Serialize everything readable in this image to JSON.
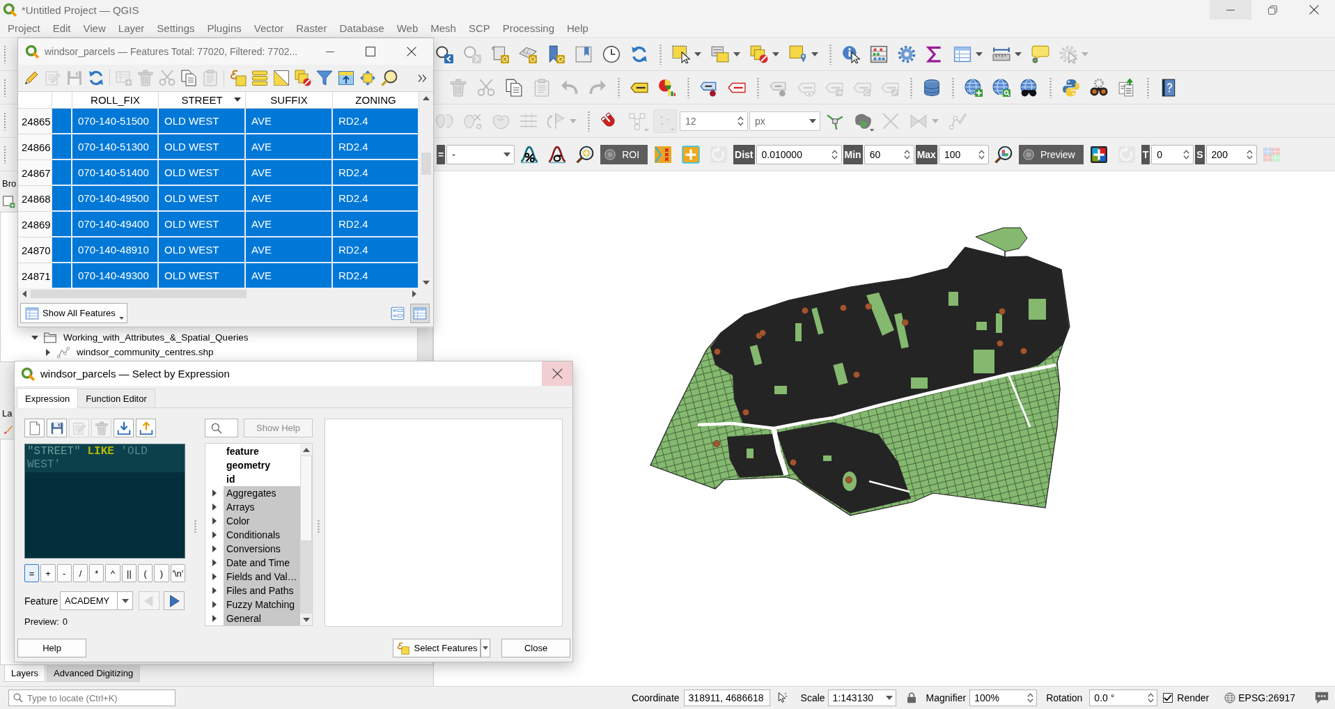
{
  "window": {
    "title": "*Untitled Project — QGIS"
  },
  "menu": [
    "Project",
    "Edit",
    "View",
    "Layer",
    "Settings",
    "Plugins",
    "Vector",
    "Raster",
    "Database",
    "Web",
    "Mesh",
    "SCP",
    "Processing",
    "Help"
  ],
  "toolbars": [
    {
      "groups": [
        [
          {
            "kind": "icon",
            "disabled": false
          },
          {
            "kind": "icon",
            "disabled": true
          },
          {
            "kind": "icon",
            "disabled": false
          },
          {
            "kind": "icon",
            "disabled": false
          },
          {
            "kind": "icon",
            "disabled": false
          },
          {
            "kind": "icon",
            "disabled": false
          },
          {
            "kind": "icon",
            "disabled": false
          },
          {
            "kind": "icon",
            "disabled": false
          }
        ],
        [
          {
            "kind": "menu_icon",
            "disabled": false
          },
          {
            "kind": "menu_icon",
            "disabled": false
          },
          {
            "kind": "menu_icon",
            "disabled": false
          },
          {
            "kind": "menu_icon",
            "disabled": false
          }
        ],
        [
          {
            "kind": "icon",
            "disabled": false
          },
          {
            "kind": "icon",
            "disabled": false
          },
          {
            "kind": "icon",
            "disabled": false
          },
          {
            "kind": "icon",
            "disabled": false
          },
          {
            "kind": "menu_icon",
            "disabled": false
          },
          {
            "kind": "menu_icon",
            "disabled": false
          },
          {
            "kind": "icon",
            "disabled": false
          },
          {
            "kind": "menu_icon",
            "disabled": true
          }
        ]
      ]
    },
    {
      "groups": [
        [
          {
            "kind": "icon",
            "disabled": true
          },
          {
            "kind": "icon",
            "disabled": true
          },
          {
            "kind": "icon",
            "disabled": false
          },
          {
            "kind": "icon",
            "disabled": true
          },
          {
            "kind": "icon",
            "disabled": true
          },
          {
            "kind": "icon",
            "disabled": true
          }
        ],
        [
          {
            "kind": "icon",
            "disabled": false
          },
          {
            "kind": "icon",
            "disabled": false
          }
        ],
        [
          {
            "kind": "icon",
            "disabled": false
          },
          {
            "kind": "icon",
            "disabled": false
          }
        ],
        [
          {
            "kind": "icon",
            "disabled": true
          },
          {
            "kind": "icon",
            "disabled": true
          },
          {
            "kind": "icon",
            "disabled": true
          },
          {
            "kind": "icon",
            "disabled": true
          },
          {
            "kind": "icon",
            "disabled": true
          }
        ],
        [
          {
            "kind": "icon",
            "disabled": false
          }
        ],
        [
          {
            "kind": "icon",
            "disabled": false
          },
          {
            "kind": "icon",
            "disabled": false
          },
          {
            "kind": "icon",
            "disabled": false
          }
        ],
        [
          {
            "kind": "icon",
            "disabled": false
          },
          {
            "kind": "icon",
            "disabled": false
          },
          {
            "kind": "icon",
            "disabled": false
          }
        ],
        [
          {
            "kind": "icon",
            "disabled": false
          }
        ]
      ]
    },
    {
      "groups": [
        [
          {
            "kind": "icon",
            "disabled": true
          },
          {
            "kind": "icon",
            "disabled": true
          },
          {
            "kind": "icon",
            "disabled": true
          },
          {
            "kind": "icon",
            "disabled": true
          },
          {
            "kind": "menu_icon",
            "disabled": true
          }
        ],
        [
          {
            "kind": "icon",
            "disabled": false
          },
          {
            "kind": "corner_menu_icon",
            "disabled": true
          },
          {
            "kind": "icon",
            "disabled": true
          },
          {
            "kind": "spin",
            "value": "12",
            "disabled": true
          },
          {
            "kind": "combo",
            "value": "px",
            "disabled": true
          },
          {
            "kind": "icon",
            "disabled": false
          },
          {
            "kind": "corner_menu_icon",
            "disabled": false
          },
          {
            "kind": "icon",
            "disabled": true
          },
          {
            "kind": "menu_icon",
            "disabled": true
          },
          {
            "kind": "icon",
            "disabled": true
          }
        ]
      ]
    },
    {
      "groups": [
        [
          {
            "kind": "label",
            "text": "=",
            "disabled": false
          },
          {
            "kind": "combo",
            "value": "-",
            "disabled": false
          },
          {
            "kind": "icon",
            "disabled": false
          },
          {
            "kind": "icon",
            "disabled": false
          },
          {
            "kind": "icon",
            "disabled": false
          },
          {
            "kind": "toggle",
            "text": "ROI",
            "checked": false,
            "disabled": false
          },
          {
            "kind": "icon",
            "disabled": false
          },
          {
            "kind": "icon",
            "disabled": false
          },
          {
            "kind": "icon",
            "disabled": true
          },
          {
            "kind": "label",
            "text": "Dist",
            "disabled": false
          },
          {
            "kind": "spin",
            "value": "0.010000",
            "disabled": false
          },
          {
            "kind": "label",
            "text": "Min",
            "disabled": false
          },
          {
            "kind": "spin",
            "value": "60",
            "disabled": false
          },
          {
            "kind": "label",
            "text": "Max",
            "disabled": false
          },
          {
            "kind": "spin",
            "value": "100",
            "disabled": false
          },
          {
            "kind": "icon",
            "disabled": false
          },
          {
            "kind": "toggle",
            "text": "Preview",
            "checked": false,
            "disabled": false
          },
          {
            "kind": "icon",
            "disabled": false
          },
          {
            "kind": "icon",
            "disabled": true
          },
          {
            "kind": "label",
            "text": "T",
            "disabled": false
          },
          {
            "kind": "spin",
            "value": "0",
            "disabled": false
          },
          {
            "kind": "label",
            "text": "S",
            "disabled": false
          },
          {
            "kind": "spin",
            "value": "200",
            "disabled": false
          },
          {
            "kind": "icon",
            "disabled": false
          }
        ]
      ]
    }
  ],
  "browser_panel": {
    "title": "Bro",
    "tree": [
      {
        "label": "Working_with_Attributes_&_Spatial_Queries",
        "kind": "folder",
        "expanded": true,
        "children": [
          {
            "label": "windsor_community_centres.shp",
            "kind": "layer",
            "expanded": false
          }
        ]
      }
    ]
  },
  "layers_panel": {
    "title": "La"
  },
  "dock_tabs": [
    {
      "label": "Layers",
      "selected": true
    },
    {
      "label": "Advanced Digitizing",
      "selected": false
    }
  ],
  "attribute_table": {
    "title": "windsor_parcels — Features Total: 77020, Filtered: 7702...",
    "toolbar": {
      "groups": [
        [
          {
            "kind": "icon",
            "disabled": false
          },
          {
            "kind": "icon",
            "disabled": true
          },
          {
            "kind": "icon",
            "disabled": true
          },
          {
            "kind": "icon",
            "disabled": false
          }
        ],
        [
          {
            "kind": "icon",
            "disabled": true
          },
          {
            "kind": "icon",
            "disabled": true
          },
          {
            "kind": "icon",
            "disabled": true
          },
          {
            "kind": "icon",
            "disabled": false
          },
          {
            "kind": "icon",
            "disabled": true
          }
        ],
        [
          {
            "kind": "icon",
            "disabled": false
          },
          {
            "kind": "icon",
            "disabled": false
          },
          {
            "kind": "icon",
            "disabled": false
          },
          {
            "kind": "icon",
            "disabled": false
          },
          {
            "kind": "icon",
            "disabled": false
          },
          {
            "kind": "icon",
            "disabled": false
          },
          {
            "kind": "icon",
            "disabled": false
          },
          {
            "kind": "icon",
            "disabled": false
          }
        ]
      ]
    },
    "columns": [
      {
        "label": "ROLL_FIX",
        "sorted": false
      },
      {
        "label": "STREET",
        "sorted": true
      },
      {
        "label": "SUFFIX",
        "sorted": false
      },
      {
        "label": "ZONING",
        "sorted": false
      }
    ],
    "rows": [
      {
        "number": "24865",
        "cells": [
          "070-140-51500",
          "OLD WEST",
          "AVE",
          "RD2.4"
        ],
        "selected": true
      },
      {
        "number": "24866",
        "cells": [
          "070-140-51300",
          "OLD WEST",
          "AVE",
          "RD2.4"
        ],
        "selected": true
      },
      {
        "number": "24867",
        "cells": [
          "070-140-51400",
          "OLD WEST",
          "AVE",
          "RD2.4"
        ],
        "selected": true
      },
      {
        "number": "24868",
        "cells": [
          "070-140-49500",
          "OLD WEST",
          "AVE",
          "RD2.4"
        ],
        "selected": true
      },
      {
        "number": "24869",
        "cells": [
          "070-140-49400",
          "OLD WEST",
          "AVE",
          "RD2.4"
        ],
        "selected": true
      },
      {
        "number": "24870",
        "cells": [
          "070-140-48910",
          "OLD WEST",
          "AVE",
          "RD2.4"
        ],
        "selected": true
      },
      {
        "number": "24871",
        "cells": [
          "070-140-49300",
          "OLD WEST",
          "AVE",
          "RD2.4"
        ],
        "selected": true
      }
    ],
    "show_button": "Show All Features",
    "view_buttons": [
      {
        "selected": false
      },
      {
        "selected": true
      }
    ]
  },
  "expression_dialog": {
    "title": "windsor_parcels — Select by Expression",
    "tabs": [
      {
        "label": "Expression",
        "selected": true
      },
      {
        "label": "Function Editor",
        "selected": false
      }
    ],
    "tools": [
      {
        "disabled": false
      },
      {
        "disabled": false
      },
      {
        "disabled": true
      },
      {
        "disabled": true
      },
      {
        "disabled": false
      },
      {
        "disabled": false
      }
    ],
    "expression": [
      {
        "kind": "field",
        "text": "\"STREET\""
      },
      {
        "kind": "keyword",
        "text": "LIKE"
      },
      {
        "kind": "string",
        "text": "'OLD WEST'"
      }
    ],
    "operators": [
      {
        "label": "=",
        "focused": true
      },
      {
        "label": "+",
        "focused": false
      },
      {
        "label": "-",
        "focused": false
      },
      {
        "label": "/",
        "focused": false
      },
      {
        "label": "*",
        "focused": false
      },
      {
        "label": "^",
        "focused": false
      },
      {
        "label": "||",
        "focused": false
      },
      {
        "label": "(",
        "focused": false
      },
      {
        "label": ")",
        "focused": false
      },
      {
        "label": "'\\n'",
        "focused": false
      }
    ],
    "feature_label": "Feature",
    "feature": "ACADEMY",
    "navigation": [
      {
        "disabled": true
      },
      {
        "disabled": false
      }
    ],
    "preview_label": "Preview:",
    "preview": "0",
    "show_help": {
      "label": "Show Help",
      "disabled": true
    },
    "functions": [
      {
        "label": "feature",
        "kind": "entry"
      },
      {
        "label": "geometry",
        "kind": "entry"
      },
      {
        "label": "id",
        "kind": "entry"
      },
      {
        "label": "Aggregates",
        "kind": "group",
        "expanded": false
      },
      {
        "label": "Arrays",
        "kind": "group",
        "expanded": false
      },
      {
        "label": "Color",
        "kind": "group",
        "expanded": false
      },
      {
        "label": "Conditionals",
        "kind": "group",
        "expanded": false
      },
      {
        "label": "Conversions",
        "kind": "group",
        "expanded": false
      },
      {
        "label": "Date and Time",
        "kind": "group",
        "expanded": false
      },
      {
        "label": "Fields and Val…",
        "kind": "group",
        "expanded": false
      },
      {
        "label": "Files and Paths",
        "kind": "group",
        "expanded": false
      },
      {
        "label": "Fuzzy Matching",
        "kind": "group",
        "expanded": false
      },
      {
        "label": "General",
        "kind": "group",
        "expanded": false
      }
    ],
    "buttons": [
      {
        "label": "Help",
        "kind": "plain"
      },
      {
        "label": "Select Features",
        "kind": "split"
      },
      {
        "label": "Close",
        "kind": "plain"
      }
    ]
  },
  "status_bar": {
    "locator_placeholder": "Type to locate (Ctrl+K)",
    "coordinate_label": "Coordinate",
    "coordinate": "318911, 4686618",
    "scale_label": "Scale",
    "scale": "1:143130",
    "magnifier_label": "Magnifier",
    "magnifier": "100%",
    "rotation_label": "Rotation",
    "rotation": "0.0 °",
    "render_label": "Render",
    "render_checked": true,
    "crs": "EPSG:26917"
  }
}
